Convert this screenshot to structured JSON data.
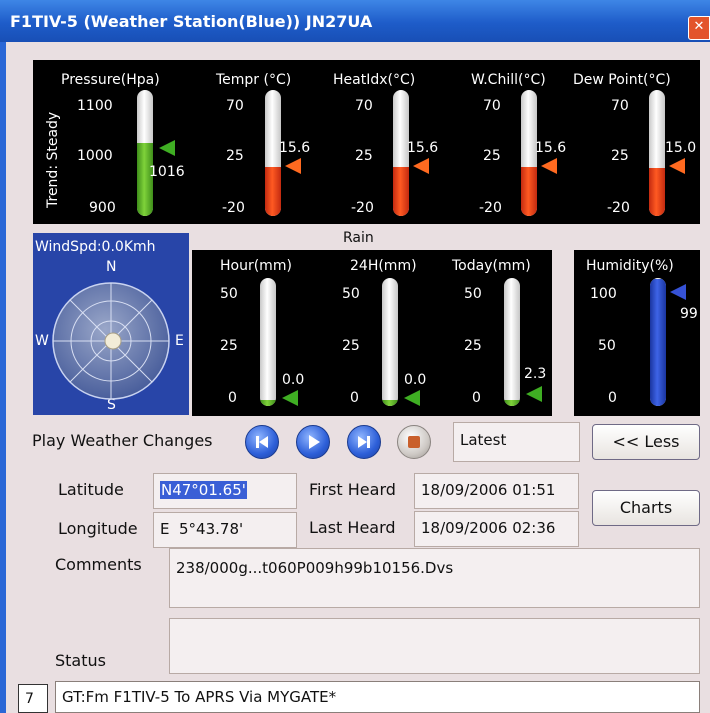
{
  "window": {
    "title": "F1TIV-5 (Weather Station(Blue)) JN27UA",
    "close_glyph": "✕"
  },
  "top_gauges": {
    "trend_label": "Trend: Steady",
    "pressure": {
      "label": "Pressure(Hpa)",
      "ticks": [
        "1100",
        "1000",
        "900"
      ],
      "value": "1016",
      "level": 0.58
    },
    "temp": {
      "label": "Tempr (°C)",
      "ticks": [
        "70",
        "25",
        "-20"
      ],
      "value": "15.6",
      "level": 0.39
    },
    "heat": {
      "label": "HeatIdx(°C)",
      "ticks": [
        "70",
        "25",
        "-20"
      ],
      "value": "15.6",
      "level": 0.39
    },
    "chill": {
      "label": "W.Chill(°C)",
      "ticks": [
        "70",
        "25",
        "-20"
      ],
      "value": "15.6",
      "level": 0.39
    },
    "dew": {
      "label": "Dew Point(°C)",
      "ticks": [
        "70",
        "25",
        "-20"
      ],
      "value": "15.0",
      "level": 0.38
    }
  },
  "wind": {
    "speed_label": "WindSpd:0.0Kmh",
    "n": "N",
    "s": "S",
    "e": "E",
    "w": "W"
  },
  "rain": {
    "title": "Rain",
    "hour": {
      "label": "Hour(mm)",
      "ticks": [
        "50",
        "25",
        "0"
      ],
      "value": "0.0",
      "level": 0.0
    },
    "h24": {
      "label": "24H(mm)",
      "ticks": [
        "50",
        "25",
        "0"
      ],
      "value": "0.0",
      "level": 0.0
    },
    "today": {
      "label": "Today(mm)",
      "ticks": [
        "50",
        "25",
        "0"
      ],
      "value": "2.3",
      "level": 0.046
    }
  },
  "humidity": {
    "label": "Humidity(%)",
    "ticks": [
      "100",
      "50",
      "0"
    ],
    "value": "99",
    "level": 0.99
  },
  "playback": {
    "label": "Play Weather Changes",
    "status": "Latest",
    "less_button": "<< Less"
  },
  "position": {
    "lat_label": "Latitude",
    "lat_value": "N47°01.65'",
    "lon_label": "Longitude",
    "lon_value": "E  5°43.78'",
    "first_label": "First Heard",
    "first_value": "18/09/2006 01:51",
    "last_label": "Last Heard",
    "last_value": "18/09/2006 02:36",
    "charts_button": "Charts"
  },
  "comments": {
    "label": "Comments",
    "value": "238/000g...t060P009h99b10156.Dvs"
  },
  "status": {
    "label": "Status",
    "value": ""
  },
  "footer": {
    "badge": "7",
    "text": "GT:Fm F1TIV-5 To APRS Via MYGATE*"
  },
  "colors": {
    "title_blue": "#1e5cc9",
    "red_fill": "#ff5a22",
    "green_fill": "#7fd23a",
    "humidity_fill": "#3e64e6",
    "compass_bg": "#2845a8"
  }
}
